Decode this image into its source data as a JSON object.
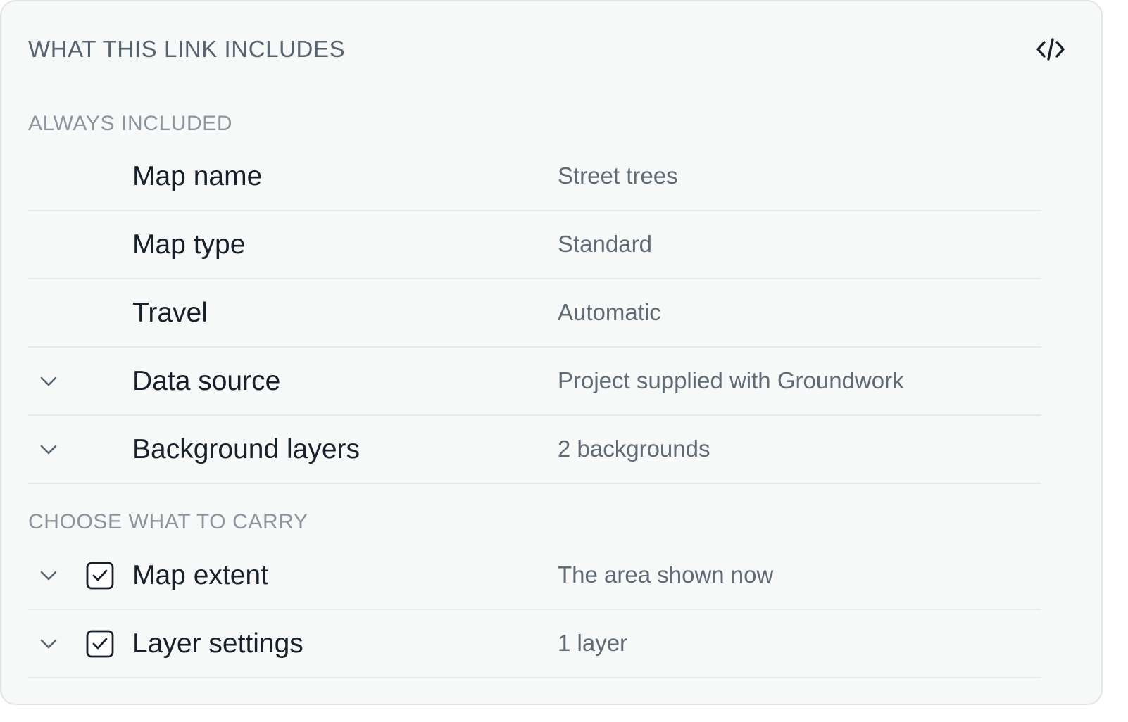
{
  "panel": {
    "title": "WHAT THIS LINK INCLUDES",
    "code_icon": "code-icon"
  },
  "sections": {
    "always": "ALWAYS INCLUDED",
    "choose": "CHOOSE WHAT TO CARRY"
  },
  "always_rows": [
    {
      "label": "Map name",
      "value": "Street trees",
      "expandable": false
    },
    {
      "label": "Map type",
      "value": "Standard",
      "expandable": false
    },
    {
      "label": "Travel",
      "value": "Automatic",
      "expandable": false
    },
    {
      "label": "Data source",
      "value": "Project supplied with Groundwork",
      "expandable": true
    },
    {
      "label": "Background layers",
      "value": "2 backgrounds",
      "expandable": true
    }
  ],
  "choose_rows": [
    {
      "label": "Map extent",
      "value": "The area shown now",
      "checked": true
    },
    {
      "label": "Layer settings",
      "value": "1 layer",
      "checked": true
    }
  ],
  "colors": {
    "panel_bg": "#f7f8f8",
    "border": "#e2e5e8",
    "text_primary": "#17212b",
    "text_secondary": "#5f6b76",
    "section_label": "#8b959e"
  }
}
